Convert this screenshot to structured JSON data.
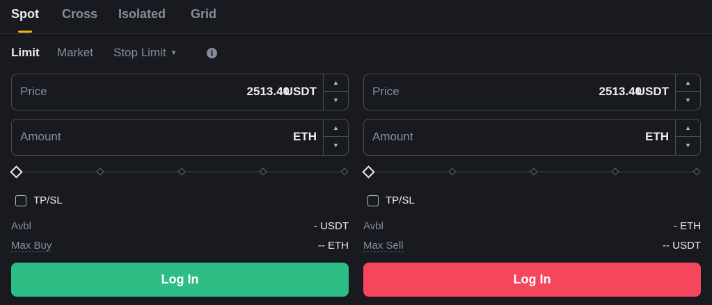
{
  "tabs": [
    {
      "label": "Spot",
      "active": true
    },
    {
      "label": "Cross",
      "active": false
    },
    {
      "label": "Isolated",
      "active": false
    },
    {
      "label": "Grid",
      "active": false
    }
  ],
  "order_types": {
    "limit": "Limit",
    "market": "Market",
    "stop_limit": "Stop Limit",
    "selected": "Limit"
  },
  "buy": {
    "price": {
      "label": "Price",
      "value": "2513.40",
      "unit": "USDT"
    },
    "amount": {
      "label": "Amount",
      "value": "",
      "unit": "ETH"
    },
    "slider_percent": 0,
    "tpsl_label": "TP/SL",
    "avbl": {
      "label": "Avbl",
      "value": "- USDT"
    },
    "max": {
      "label": "Max Buy",
      "value": "-- ETH"
    },
    "button_label": "Log In"
  },
  "sell": {
    "price": {
      "label": "Price",
      "value": "2513.40",
      "unit": "USDT"
    },
    "amount": {
      "label": "Amount",
      "value": "",
      "unit": "ETH"
    },
    "slider_percent": 0,
    "tpsl_label": "TP/SL",
    "avbl": {
      "label": "Avbl",
      "value": "- ETH"
    },
    "max": {
      "label": "Max Sell",
      "value": "-- USDT"
    },
    "button_label": "Log In"
  },
  "colors": {
    "background": "#181A20",
    "accent": "#F0B90B",
    "buy": "#2EBD85",
    "sell": "#F6465D",
    "border": "#474D57",
    "muted_text": "#848E9C"
  },
  "icons": {
    "info": "info-icon",
    "stop_limit_caret": "caret-down-icon",
    "step_up": "arrow-up-icon",
    "step_down": "arrow-down-icon"
  }
}
